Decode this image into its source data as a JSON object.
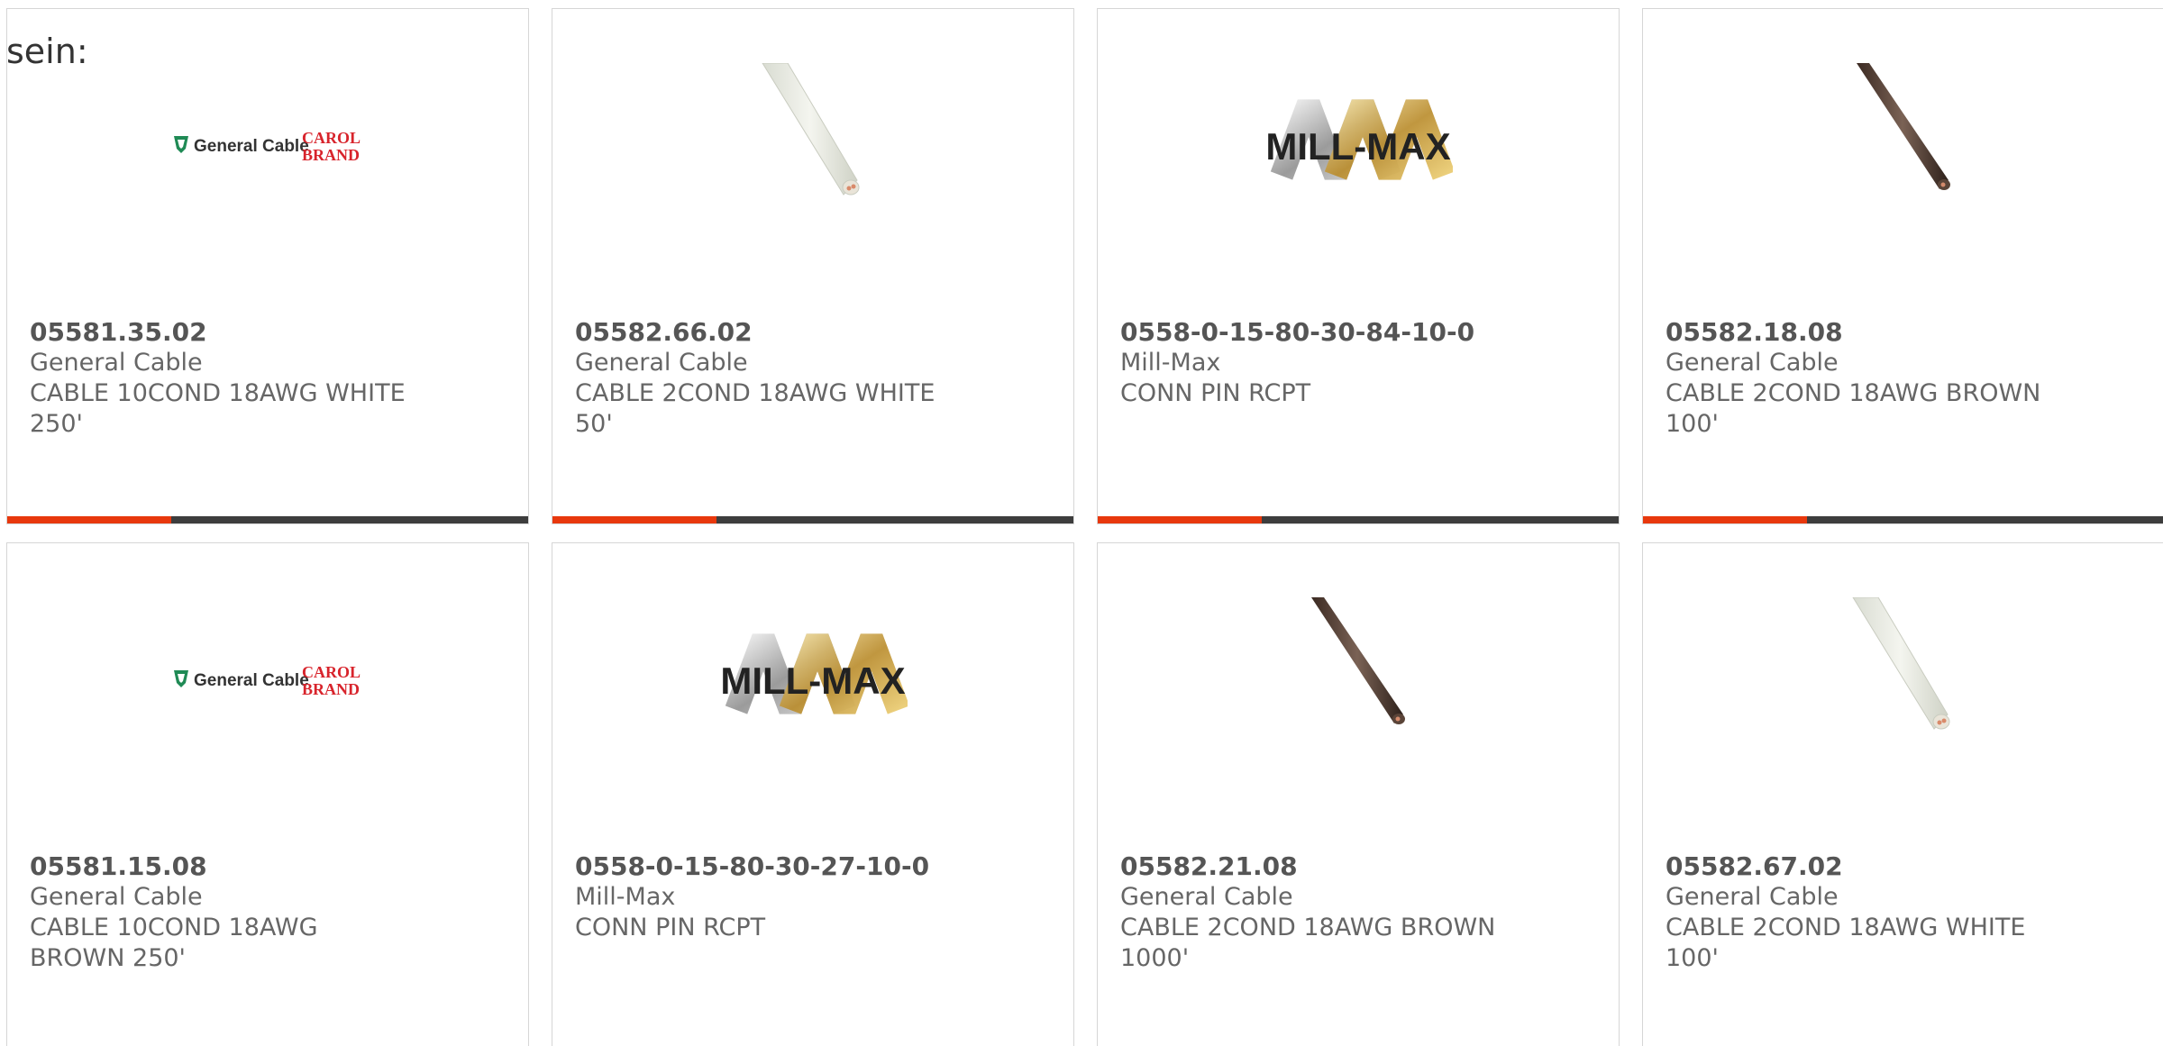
{
  "intro": {
    "text": "sein:"
  },
  "colors": {
    "accent": "#e8380d",
    "bar": "#3d3d3d",
    "text": "#666666",
    "border": "#d6d6d6"
  },
  "products": [
    {
      "part_number": "05581.35.02",
      "manufacturer": "General Cable",
      "description": "CABLE 10COND 18AWG WHITE 250'",
      "image": "general-cable-carol-brand-logo",
      "logo_text_1": "General Cable",
      "logo_text_2": "CAROL",
      "logo_text_3": "BRAND"
    },
    {
      "part_number": "05582.66.02",
      "manufacturer": "General Cable",
      "description": "CABLE 2COND 18AWG WHITE 50'",
      "image": "white-cable-photo"
    },
    {
      "part_number": "0558-0-15-80-30-84-10-0",
      "manufacturer": "Mill-Max",
      "description": "CONN PIN RCPT",
      "image": "mill-max-logo",
      "logo_text": "MILL-MAX"
    },
    {
      "part_number": "05582.18.08",
      "manufacturer": "General Cable",
      "description": "CABLE 2COND 18AWG BROWN 100'",
      "image": "brown-cable-photo"
    },
    {
      "part_number": "05581.15.08",
      "manufacturer": "General Cable",
      "description": "CABLE 10COND 18AWG BROWN 250'",
      "image": "general-cable-carol-brand-logo",
      "logo_text_1": "General Cable",
      "logo_text_2": "CAROL",
      "logo_text_3": "BRAND"
    },
    {
      "part_number": "0558-0-15-80-30-27-10-0",
      "manufacturer": "Mill-Max",
      "description": "CONN PIN RCPT",
      "image": "mill-max-logo",
      "logo_text": "MILL-MAX"
    },
    {
      "part_number": "05582.21.08",
      "manufacturer": "General Cable",
      "description": "CABLE 2COND 18AWG BROWN 1000'",
      "image": "brown-cable-photo"
    },
    {
      "part_number": "05582.67.02",
      "manufacturer": "General Cable",
      "description": "CABLE 2COND 18AWG WHITE 100'",
      "image": "white-cable-photo"
    }
  ]
}
